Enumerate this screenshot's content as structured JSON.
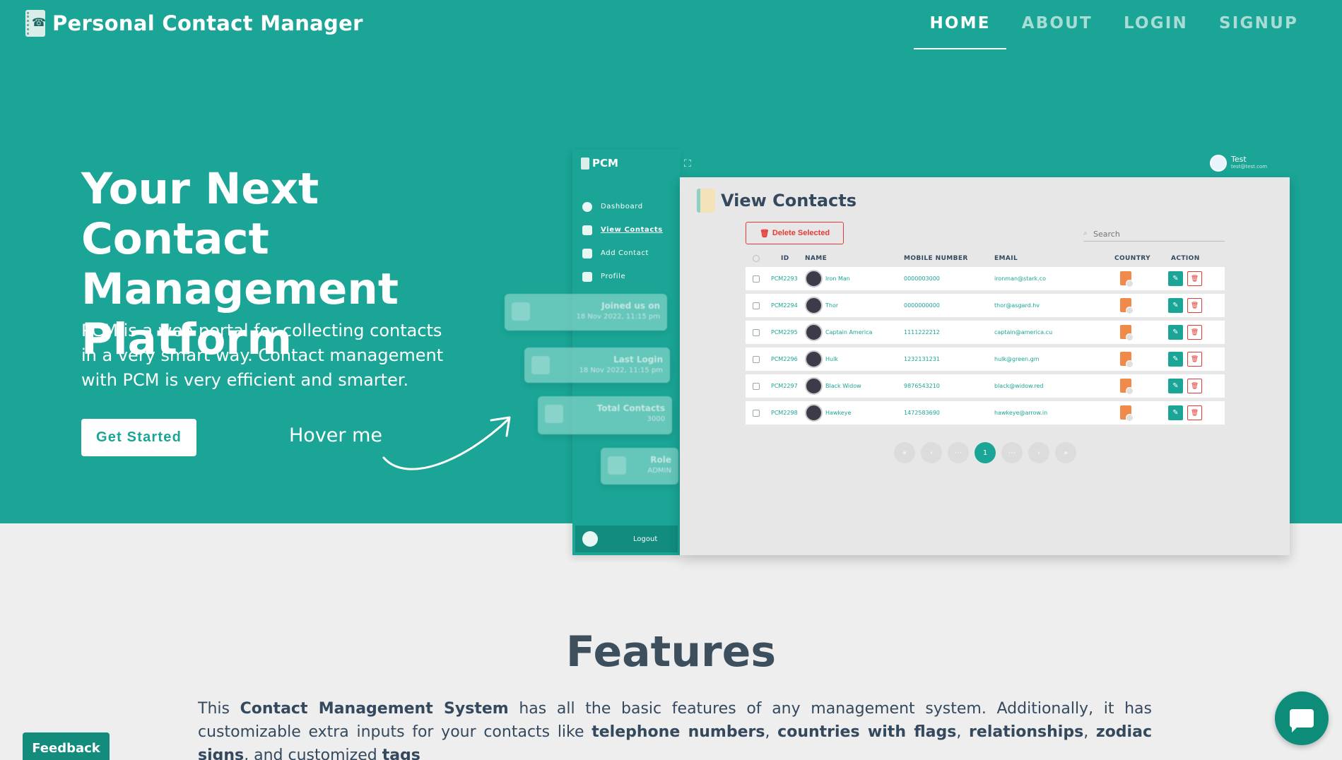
{
  "colors": {
    "primary": "#1aa596",
    "danger": "#e53935",
    "background": "#eeeeee"
  },
  "header": {
    "title": "Personal Contact Manager",
    "nav": [
      "HOME",
      "ABOUT",
      "LOGIN",
      "SIGNUP"
    ],
    "active_nav": "HOME"
  },
  "hero": {
    "headline": "Your Next Contact Management Platform",
    "lead": "PCM is a web portal for collecting contacts in a very smart way. Contact management with PCM is very efficient and smarter.",
    "cta_label": "Get Started",
    "hover_label": "Hover me"
  },
  "mockup": {
    "brand": "PCM",
    "menu": [
      "Dashboard",
      "View Contacts",
      "Add Contact",
      "Profile"
    ],
    "logout_label": "Logout",
    "user_name": "Test",
    "user_email": "test@test.com",
    "page_title": "View Contacts",
    "delete_selected_label": "Delete Selected",
    "search_placeholder": "Search",
    "columns": [
      "ID",
      "NAME",
      "MOBILE NUMBER",
      "EMAIL",
      "COUNTRY",
      "ACTION"
    ],
    "rows": [
      {
        "id": "PCM2293",
        "name": "Iron Man",
        "mobile": "0000003000",
        "email": "ironman@stark.co"
      },
      {
        "id": "PCM2294",
        "name": "Thor",
        "mobile": "0000000000",
        "email": "thor@asgard.hv"
      },
      {
        "id": "PCM2295",
        "name": "Captain America",
        "mobile": "1111222212",
        "email": "captain@america.cu"
      },
      {
        "id": "PCM2296",
        "name": "Hulk",
        "mobile": "1232131231",
        "email": "hulk@green.gm"
      },
      {
        "id": "PCM2297",
        "name": "Black Widow",
        "mobile": "9876543210",
        "email": "black@widow.red"
      },
      {
        "id": "PCM2298",
        "name": "Hawkeye",
        "mobile": "1472583690",
        "email": "hawkeye@arrow.in"
      }
    ],
    "pagination": {
      "current": "1"
    },
    "stats": [
      {
        "label": "Joined us on",
        "value": "18 Nov 2022, 11:15 pm"
      },
      {
        "label": "Last Login",
        "value": "18 Nov 2022, 11:15 pm"
      },
      {
        "label": "Total Contacts",
        "value": "3000"
      },
      {
        "label": "Role",
        "value": "ADMIN"
      }
    ]
  },
  "features": {
    "title": "Features",
    "intro_1": "This ",
    "intro_bold": "Contact Management System",
    "intro_2": " has all the basic features of any management system. Additionally, it has customizable extra inputs for your contacts like ",
    "b1": "telephone numbers",
    "s1": ", ",
    "b2": "countries with flags",
    "s2": ", ",
    "b3": "relationships",
    "s3": ", ",
    "b4": "zodiac signs",
    "s4": ", and customized ",
    "b5": "tags"
  },
  "feedback_label": "Feedback"
}
